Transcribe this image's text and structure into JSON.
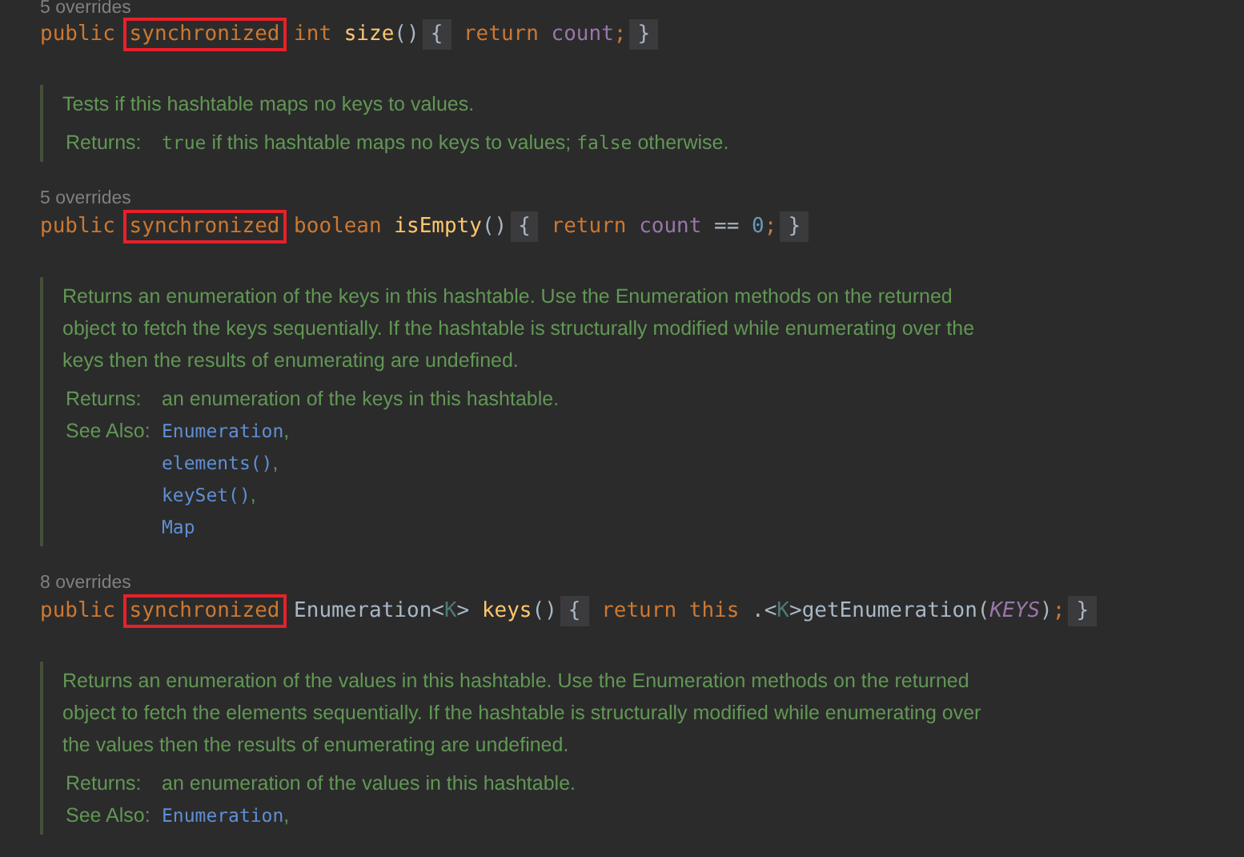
{
  "blocks": [
    {
      "kind": "overrides",
      "text": "5 overrides"
    },
    {
      "kind": "code",
      "tokens": [
        {
          "text": "public",
          "kind": "keyword"
        },
        {
          "text": "synchronized",
          "kind": "highlight"
        },
        {
          "text": "int",
          "kind": "keyword"
        },
        {
          "text": "size",
          "kind": "method"
        },
        {
          "text": "()",
          "kind": "plain"
        },
        {
          "text": "{",
          "kind": "fold"
        },
        {
          "text": "return",
          "kind": "keyword"
        },
        {
          "text": "count",
          "kind": "field"
        },
        {
          "text": ";",
          "kind": "keyword"
        },
        {
          "text": "}",
          "kind": "fold"
        }
      ]
    },
    {
      "kind": "doc",
      "description": "Tests if this hashtable maps no keys to values.",
      "returns_label": "Returns:",
      "returns": [
        {
          "text": "true",
          "kind": "code"
        },
        {
          "text": "if this hashtable maps no keys to values;",
          "kind": "prose"
        },
        {
          "text": "false",
          "kind": "code"
        },
        {
          "text": "otherwise.",
          "kind": "prose"
        }
      ]
    },
    {
      "kind": "overrides",
      "text": "5 overrides"
    },
    {
      "kind": "code",
      "tokens": [
        {
          "text": "public",
          "kind": "keyword"
        },
        {
          "text": "synchronized",
          "kind": "highlight"
        },
        {
          "text": "boolean",
          "kind": "keyword"
        },
        {
          "text": "isEmpty",
          "kind": "method"
        },
        {
          "text": "()",
          "kind": "plain"
        },
        {
          "text": "{",
          "kind": "fold"
        },
        {
          "text": "return",
          "kind": "keyword"
        },
        {
          "text": "count",
          "kind": "field"
        },
        {
          "text": "==",
          "kind": "plain"
        },
        {
          "text": "0",
          "kind": "number"
        },
        {
          "text": ";",
          "kind": "keyword"
        },
        {
          "text": "}",
          "kind": "fold"
        }
      ]
    },
    {
      "kind": "doc",
      "description": "Returns an enumeration of the keys in this hashtable. Use the Enumeration methods on the returned object to fetch the keys sequentially. If the hashtable is structurally modified while enumerating over the keys then the results of enumerating are undefined.",
      "returns_label": "Returns:",
      "returns": [
        {
          "text": "an enumeration of the keys in this hashtable.",
          "kind": "prose"
        }
      ],
      "see_also_label": "See Also:",
      "see_also": [
        {
          "text": "Enumeration",
          "sep": ","
        },
        {
          "text": "elements()",
          "sep": ","
        },
        {
          "text": "keySet()",
          "sep": ","
        },
        {
          "text": "Map"
        }
      ]
    },
    {
      "kind": "overrides",
      "text": "8 overrides"
    },
    {
      "kind": "code",
      "tokens": [
        {
          "text": "public",
          "kind": "keyword"
        },
        {
          "text": "synchronized",
          "kind": "highlight"
        },
        {
          "text": "Enumeration<",
          "kind": "plain"
        },
        {
          "text": "K",
          "kind": "generic"
        },
        {
          "text": ">",
          "kind": "plain"
        },
        {
          "text": "keys",
          "kind": "method"
        },
        {
          "text": "()",
          "kind": "plain"
        },
        {
          "text": "{",
          "kind": "fold"
        },
        {
          "text": "return",
          "kind": "keyword"
        },
        {
          "text": "this",
          "kind": "keyword"
        },
        {
          "text": ".<",
          "kind": "plain"
        },
        {
          "text": "K",
          "kind": "generic"
        },
        {
          "text": ">getEnumeration(",
          "kind": "plain"
        },
        {
          "text": "KEYS",
          "kind": "constant"
        },
        {
          "text": ")",
          "kind": "plain"
        },
        {
          "text": ";",
          "kind": "keyword"
        },
        {
          "text": "}",
          "kind": "fold"
        }
      ]
    },
    {
      "kind": "doc",
      "description": "Returns an enumeration of the values in this hashtable. Use the Enumeration methods on the returned object to fetch the elements sequentially. If the hashtable is structurally modified while enumerating over the values then the results of enumerating are undefined.",
      "returns_label": "Returns:",
      "returns": [
        {
          "text": "an enumeration of the values in this hashtable.",
          "kind": "prose"
        }
      ],
      "see_also_label": "See Also:",
      "see_also": [
        {
          "text": "Enumeration",
          "sep": ","
        }
      ]
    }
  ]
}
